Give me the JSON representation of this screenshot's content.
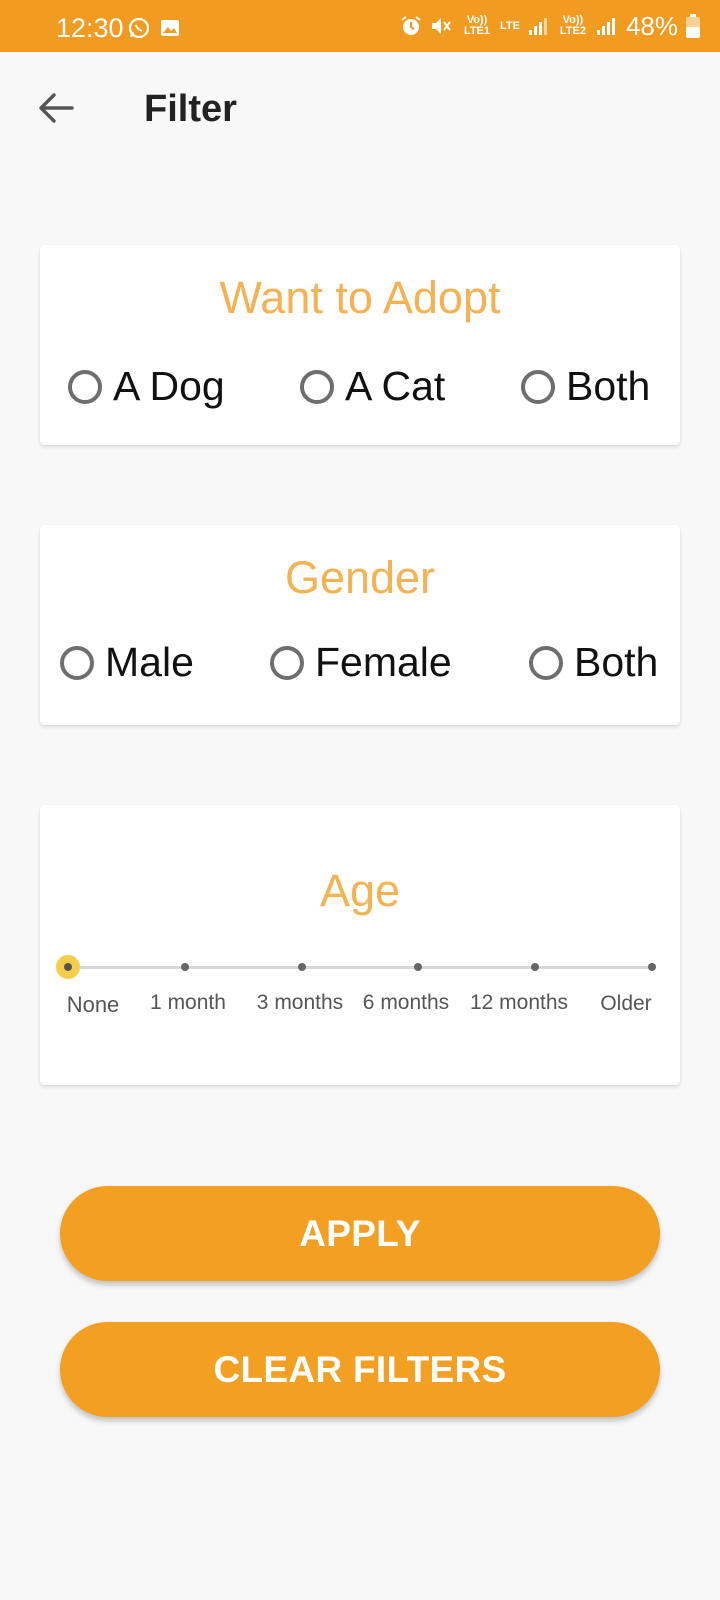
{
  "status_bar": {
    "time": "12:30",
    "sim1_label": "Vo)) LTE1",
    "network_type": "LTE",
    "sim2_label": "Vo)) LTE2",
    "battery": "48%"
  },
  "header": {
    "title": "Filter",
    "back_icon": "arrow-left-icon"
  },
  "adopt": {
    "title": "Want to Adopt",
    "options": [
      "A Dog",
      "A Cat",
      "Both"
    ]
  },
  "gender": {
    "title": "Gender",
    "options": [
      "Male",
      "Female",
      "Both"
    ]
  },
  "age": {
    "title": "Age",
    "labels": [
      "None",
      "1 month",
      "3 months",
      "6 months",
      "12 months",
      "Older"
    ],
    "selected": "None"
  },
  "buttons": {
    "apply": "APPLY",
    "clear": "CLEAR FILTERS"
  },
  "colors": {
    "accent": "#f29f22",
    "section_title": "#f4b253",
    "slider_thumb": "#f4ce4a"
  }
}
